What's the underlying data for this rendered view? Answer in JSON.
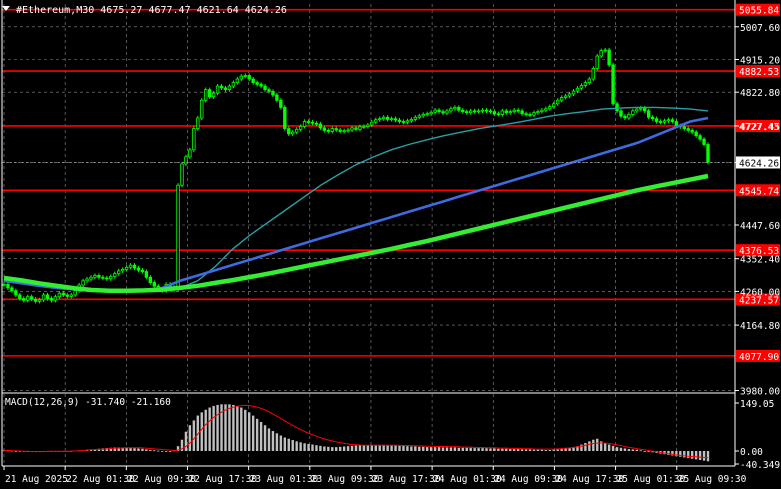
{
  "header": {
    "symbol_line": "#Ethereum,M30  4675.27 4677.47 4621.64 4624.26",
    "symbol_icon": "triangle-down-icon"
  },
  "colors": {
    "background": "#000000",
    "grid": "#ffffff",
    "candle": "#00ff00",
    "level_line": "#ff0000",
    "level_label_bg": "#ff0000",
    "ma_slow": "#33ee33",
    "ma_mid": "#3d6be0",
    "ma_fast": "#2a9fa8",
    "macd_hist": "#c0c0c0",
    "macd_signal": "#ff0000",
    "current_price_bg": "#ffffff"
  },
  "chart_data": [
    {
      "type": "line",
      "title": "#Ethereum,M30",
      "ohlc_last": {
        "open": 4675.27,
        "high": 4677.47,
        "low": 4621.64,
        "close": 4624.26
      },
      "y_ticks": [
        "5007.60",
        "4915.20",
        "4822.80",
        "4727.45",
        "4624.26",
        "4447.60",
        "4352.40",
        "4260.00",
        "4164.80",
        "3980.00"
      ],
      "ylim": [
        3973,
        5072
      ],
      "current_price": "4624.26",
      "x_ticks": [
        "21 Aug 2025",
        "22 Aug 01:30",
        "22 Aug 09:30",
        "22 Aug 17:30",
        "23 Aug 01:30",
        "23 Aug 09:30",
        "23 Aug 17:30",
        "24 Aug 01:30",
        "24 Aug 09:30",
        "24 Aug 17:30",
        "25 Aug 01:30",
        "25 Aug 09:30"
      ],
      "horizontal_levels": [
        {
          "label": "5055.84",
          "value": 5055.84
        },
        {
          "label": "4882.53",
          "value": 4882.53
        },
        {
          "label": "4727.43",
          "value": 4727.43
        },
        {
          "label": "4545.74",
          "value": 4545.74
        },
        {
          "label": "4376.53",
          "value": 4376.53
        },
        {
          "label": "4237.57",
          "value": 4237.57
        },
        {
          "label": "4077.90",
          "value": 4077.9
        }
      ],
      "price_series": {
        "name": "",
        "values": [
          4280,
          4270,
          4262,
          4250,
          4240,
          4235,
          4245,
          4238,
          4232,
          4236,
          4250,
          4240,
          4235,
          4245,
          4255,
          4250,
          4246,
          4250,
          4262,
          4278,
          4290,
          4295,
          4300,
          4305,
          4300,
          4298,
          4296,
          4302,
          4310,
          4318,
          4322,
          4328,
          4334,
          4326,
          4320,
          4316,
          4300,
          4285,
          4275,
          4268,
          4262,
          4280,
          4272,
          4265,
          4560,
          4620,
          4640,
          4660,
          4720,
          4750,
          4800,
          4830,
          4810,
          4820,
          4840,
          4835,
          4830,
          4840,
          4850,
          4860,
          4868,
          4870,
          4860,
          4850,
          4845,
          4840,
          4830,
          4825,
          4815,
          4800,
          4780,
          4720,
          4705,
          4710,
          4718,
          4726,
          4740,
          4738,
          4735,
          4733,
          4722,
          4715,
          4712,
          4720,
          4716,
          4712,
          4714,
          4716,
          4722,
          4718,
          4725,
          4726,
          4730,
          4738,
          4745,
          4748,
          4752,
          4746,
          4748,
          4744,
          4740,
          4738,
          4742,
          4746,
          4752,
          4756,
          4760,
          4762,
          4766,
          4772,
          4768,
          4764,
          4770,
          4776,
          4780,
          4772,
          4768,
          4765,
          4770,
          4768,
          4770,
          4772,
          4770,
          4768,
          4762,
          4760,
          4770,
          4765,
          4768,
          4772,
          4770,
          4762,
          4760,
          4758,
          4765,
          4768,
          4772,
          4776,
          4782,
          4790,
          4800,
          4808,
          4812,
          4818,
          4826,
          4834,
          4842,
          4850,
          4860,
          4890,
          4925,
          4940,
          4942,
          4900,
          4790,
          4770,
          4755,
          4750,
          4760,
          4770,
          4775,
          4778,
          4770,
          4752,
          4748,
          4740,
          4738,
          4742,
          4745,
          4740,
          4728,
          4725,
          4720,
          4715,
          4710,
          4700,
          4690,
          4675,
          4625
        ]
      },
      "series": [
        {
          "name": "",
          "values": [
            4290,
            4284,
            4277,
            4271,
            4266,
            4262,
            4260,
            4259,
            4260,
            4262,
            4270,
            4290,
            4330,
            4380,
            4420,
            4455,
            4490,
            4525,
            4560,
            4590,
            4618,
            4640,
            4660,
            4675,
            4688,
            4700,
            4710,
            4720,
            4728,
            4736,
            4745,
            4755,
            4762,
            4768,
            4775,
            4778,
            4780,
            4780,
            4778,
            4775,
            4770
          ]
        },
        {
          "name": "",
          "values": [
            4290,
            4283,
            4276,
            4270,
            4266,
            4263,
            4262,
            4262,
            4264,
            4270,
            4290,
            4305,
            4320,
            4335,
            4350,
            4365,
            4380,
            4395,
            4410,
            4425,
            4440,
            4455,
            4470,
            4485,
            4500,
            4515,
            4530,
            4545,
            4560,
            4575,
            4590,
            4605,
            4620,
            4635,
            4650,
            4665,
            4680,
            4700,
            4720,
            4740,
            4750
          ]
        },
        {
          "name": "",
          "values": [
            4298,
            4291,
            4283,
            4276,
            4269,
            4264,
            4262,
            4262,
            4263,
            4265,
            4270,
            4276,
            4284,
            4292,
            4301,
            4310,
            4320,
            4330,
            4340,
            4350,
            4360,
            4370,
            4380,
            4391,
            4402,
            4414,
            4426,
            4438,
            4450,
            4462,
            4474,
            4486,
            4498,
            4510,
            4522,
            4534,
            4546,
            4556,
            4566,
            4576,
            4586
          ]
        }
      ]
    },
    {
      "type": "bar",
      "title": "MACD(12,26,9) -31.740 -21.160",
      "indicator_label": "MACD(12,26,9) -31.740 -21.160",
      "y_ticks": [
        "149.05",
        "0.00",
        "-40.349"
      ],
      "ylim": [
        -40.349,
        149.05
      ],
      "histogram": [
        2,
        2,
        1,
        0,
        -1,
        -2,
        -3,
        -3,
        -3,
        -2,
        -1,
        0,
        0,
        -1,
        -2,
        -2,
        -1,
        0,
        1,
        2,
        3,
        4,
        5,
        6,
        7,
        8,
        9,
        10,
        11,
        11,
        11,
        11,
        10,
        9,
        8,
        7,
        5,
        3,
        2,
        1,
        0,
        0,
        0,
        2,
        15,
        35,
        60,
        80,
        95,
        110,
        120,
        128,
        135,
        140,
        143,
        145,
        145,
        145,
        143,
        140,
        135,
        128,
        120,
        110,
        100,
        90,
        80,
        70,
        62,
        55,
        48,
        42,
        38,
        34,
        30,
        27,
        24,
        22,
        20,
        18,
        16,
        14,
        13,
        12,
        12,
        13,
        14,
        15,
        16,
        17,
        18,
        18,
        18,
        19,
        19,
        19,
        19,
        18,
        18,
        17,
        16,
        16,
        15,
        14,
        14,
        13,
        13,
        12,
        12,
        12,
        12,
        11,
        11,
        11,
        11,
        10,
        10,
        10,
        10,
        9,
        9,
        9,
        9,
        8,
        8,
        7,
        7,
        7,
        6,
        6,
        6,
        5,
        5,
        5,
        4,
        4,
        4,
        3,
        3,
        4,
        5,
        6,
        8,
        10,
        12,
        15,
        20,
        25,
        30,
        35,
        38,
        30,
        24,
        20,
        16,
        12,
        10,
        8,
        6,
        5,
        4,
        2,
        0,
        -2,
        -4,
        -6,
        -8,
        -10,
        -12,
        -14,
        -16,
        -18,
        -20,
        -22,
        -24,
        -26,
        -28,
        -30,
        -32
      ],
      "signal": [
        2,
        2,
        1,
        1,
        0,
        -1,
        -1,
        -2,
        -2,
        -2,
        -2,
        -1,
        -1,
        -1,
        -1,
        -1,
        -1,
        0,
        0,
        1,
        2,
        3,
        4,
        5,
        5,
        6,
        7,
        8,
        9,
        9,
        10,
        10,
        10,
        10,
        10,
        9,
        8,
        7,
        6,
        5,
        4,
        3,
        2,
        2,
        5,
        12,
        22,
        35,
        50,
        65,
        80,
        92,
        103,
        112,
        120,
        127,
        132,
        136,
        139,
        141,
        142,
        141,
        139,
        136,
        132,
        127,
        121,
        114,
        107,
        100,
        92,
        85,
        78,
        71,
        65,
        59,
        54,
        49,
        44,
        40,
        36,
        33,
        30,
        27,
        25,
        23,
        21,
        20,
        19,
        18,
        18,
        18,
        18,
        18,
        18,
        18,
        18,
        18,
        18,
        17,
        17,
        17,
        16,
        16,
        16,
        15,
        15,
        15,
        14,
        14,
        14,
        13,
        13,
        13,
        12,
        12,
        12,
        11,
        11,
        11,
        10,
        10,
        10,
        9,
        9,
        9,
        8,
        8,
        8,
        7,
        7,
        7,
        6,
        6,
        6,
        6,
        6,
        6,
        7,
        8,
        9,
        10,
        12,
        14,
        16,
        19,
        22,
        24,
        25,
        25,
        24,
        22,
        20,
        18,
        15,
        12,
        10,
        8,
        6,
        4,
        2,
        0,
        -2,
        -4,
        -6,
        -8,
        -10,
        -12,
        -14,
        -15,
        -16,
        -17,
        -18,
        -19,
        -20,
        -21
      ]
    }
  ]
}
